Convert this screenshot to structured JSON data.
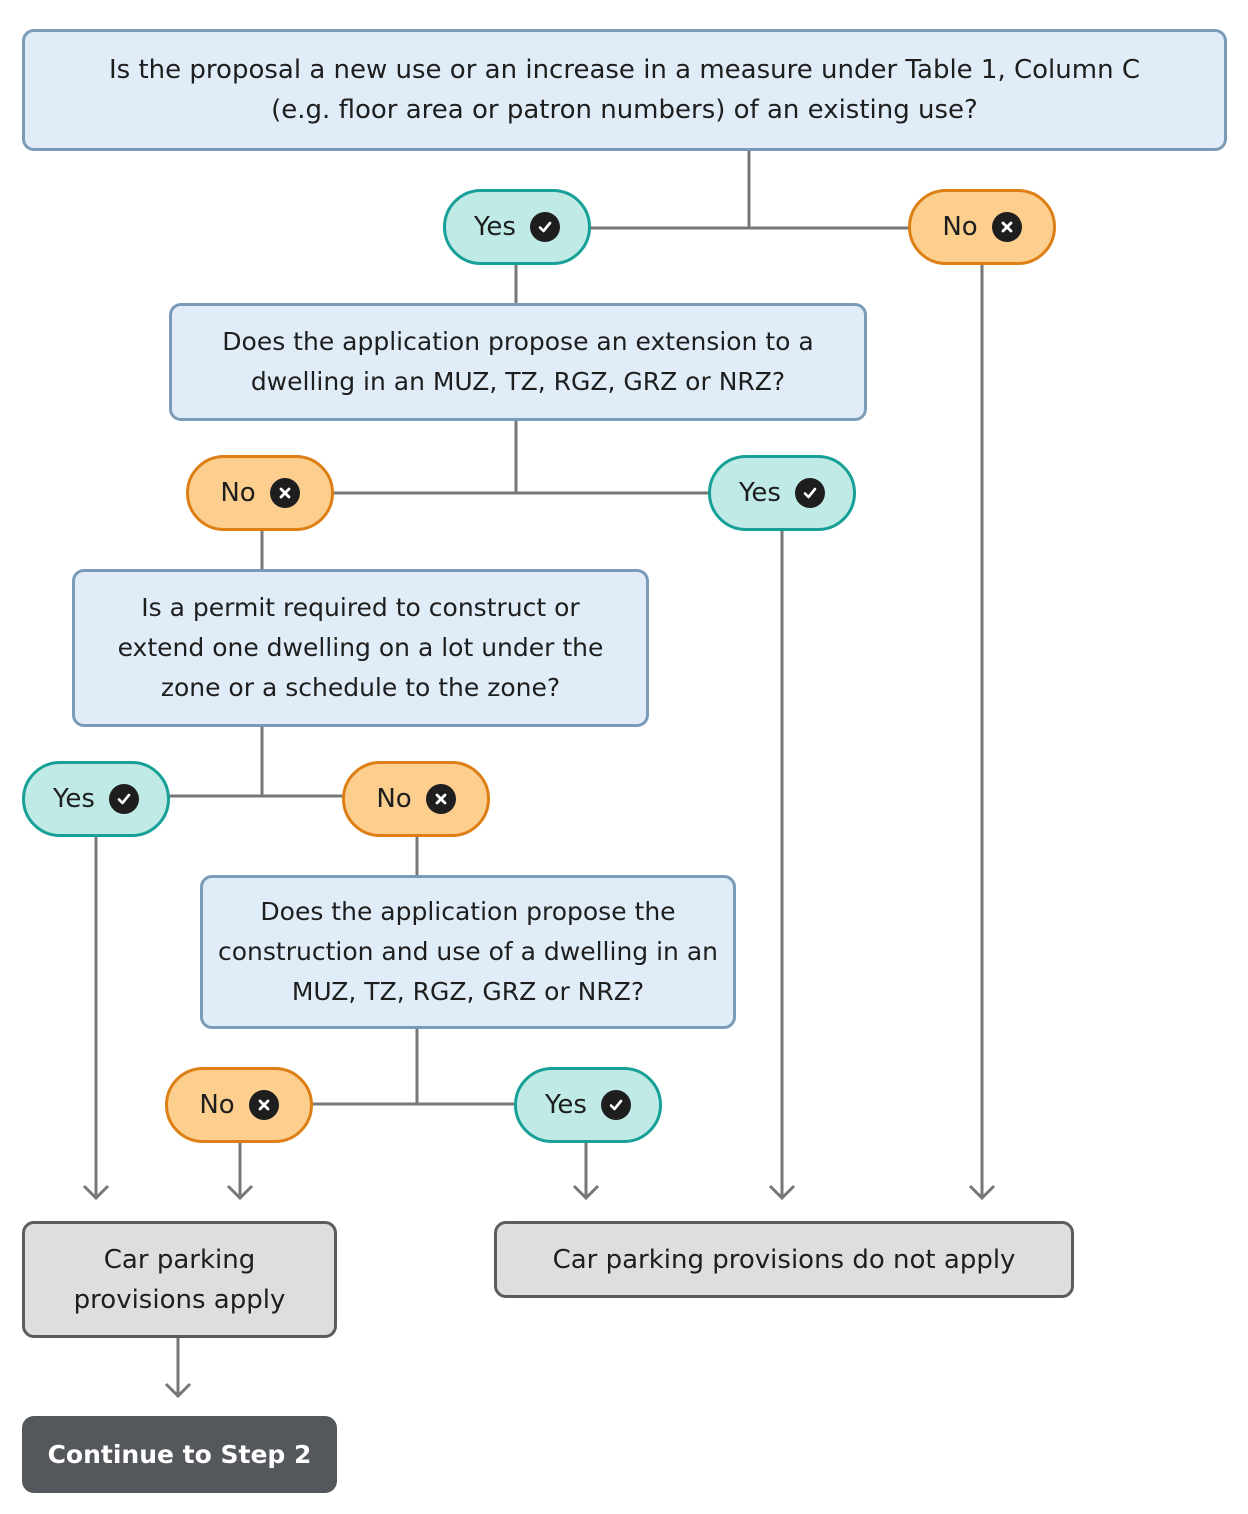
{
  "diagram": {
    "questions": {
      "q1": "Is the proposal a new use or an increase in a measure under Table 1, Column C (e.g. floor area or patron numbers) of an existing use?",
      "q2": "Does the application propose an extension to a dwelling in an MUZ, TZ, RGZ, GRZ or NRZ?",
      "q3": "Is a permit required to construct or extend one dwelling on a lot under the zone or a schedule to the zone?",
      "q4": "Does the application propose the construction and use of a dwelling in an MUZ, TZ, RGZ, GRZ or NRZ?"
    },
    "answers": {
      "yes_label": "Yes",
      "no_label": "No",
      "yes_icon": "check-circle-icon",
      "no_icon": "x-circle-icon"
    },
    "results": {
      "apply": "Car parking provisions apply",
      "not_apply": "Car parking provisions do not apply"
    },
    "continue_label": "Continue to Step 2",
    "colors": {
      "question_fill": "#e0ecf8",
      "question_border": "#7b9bb6",
      "yes_fill": "#bfeae6",
      "yes_border": "#17a097",
      "no_fill": "#fdcf8f",
      "no_border": "#dd7f15",
      "result_fill": "#dedede",
      "result_border": "#5a5c60",
      "continue_fill": "#54575c",
      "connector": "#777777"
    }
  }
}
